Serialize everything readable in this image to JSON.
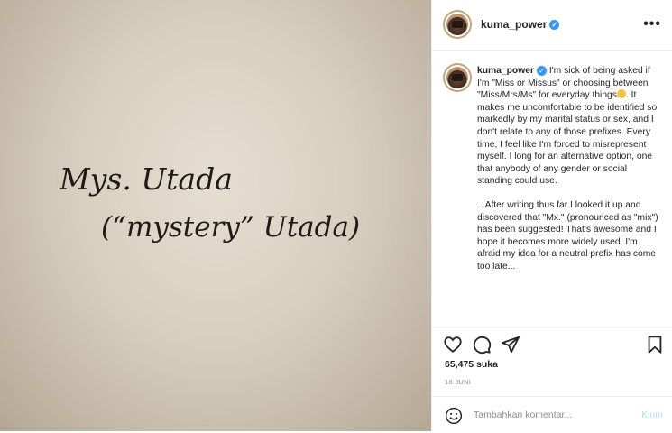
{
  "post": {
    "author": "kuma_power",
    "photo_text_line1": "Mys. Utada",
    "photo_text_line2": "(“mystery” Utada)",
    "caption_p1": "I'm sick of being asked if I'm \"Miss or Missus\" or choosing between \"Miss/Mrs/Ms\" for everyday things",
    "caption_p1_end": ". It makes me uncomfortable to be identified so markedly by my marital status or sex, and I don't relate to any of those prefixes. Every time, I feel like I'm forced to misrepresent myself. I long for an alternative option, one that anybody of any gender or social standing could use.",
    "caption_p2": "...After writing thus far I looked it up and discovered that \"Mx.\" (pronounced as \"mix\") has been suggested! That's awesome and I hope it becomes more widely used. I'm afraid my idea for a neutral prefix has come too late...",
    "likes": "65,475 suka",
    "date": "18 JUNI",
    "comment_placeholder": "Tambahkan komentar...",
    "post_button": "Kirim"
  },
  "icons": {
    "verified": "verified-badge-icon",
    "more": "more-options-icon",
    "like": "heart-icon",
    "comment": "comment-icon",
    "share": "share-icon",
    "save": "bookmark-icon",
    "emoji": "smile-icon"
  },
  "colors": {
    "verified": "#3897f0",
    "post_button": "#b2dffc",
    "muted": "#8e8e8e"
  }
}
